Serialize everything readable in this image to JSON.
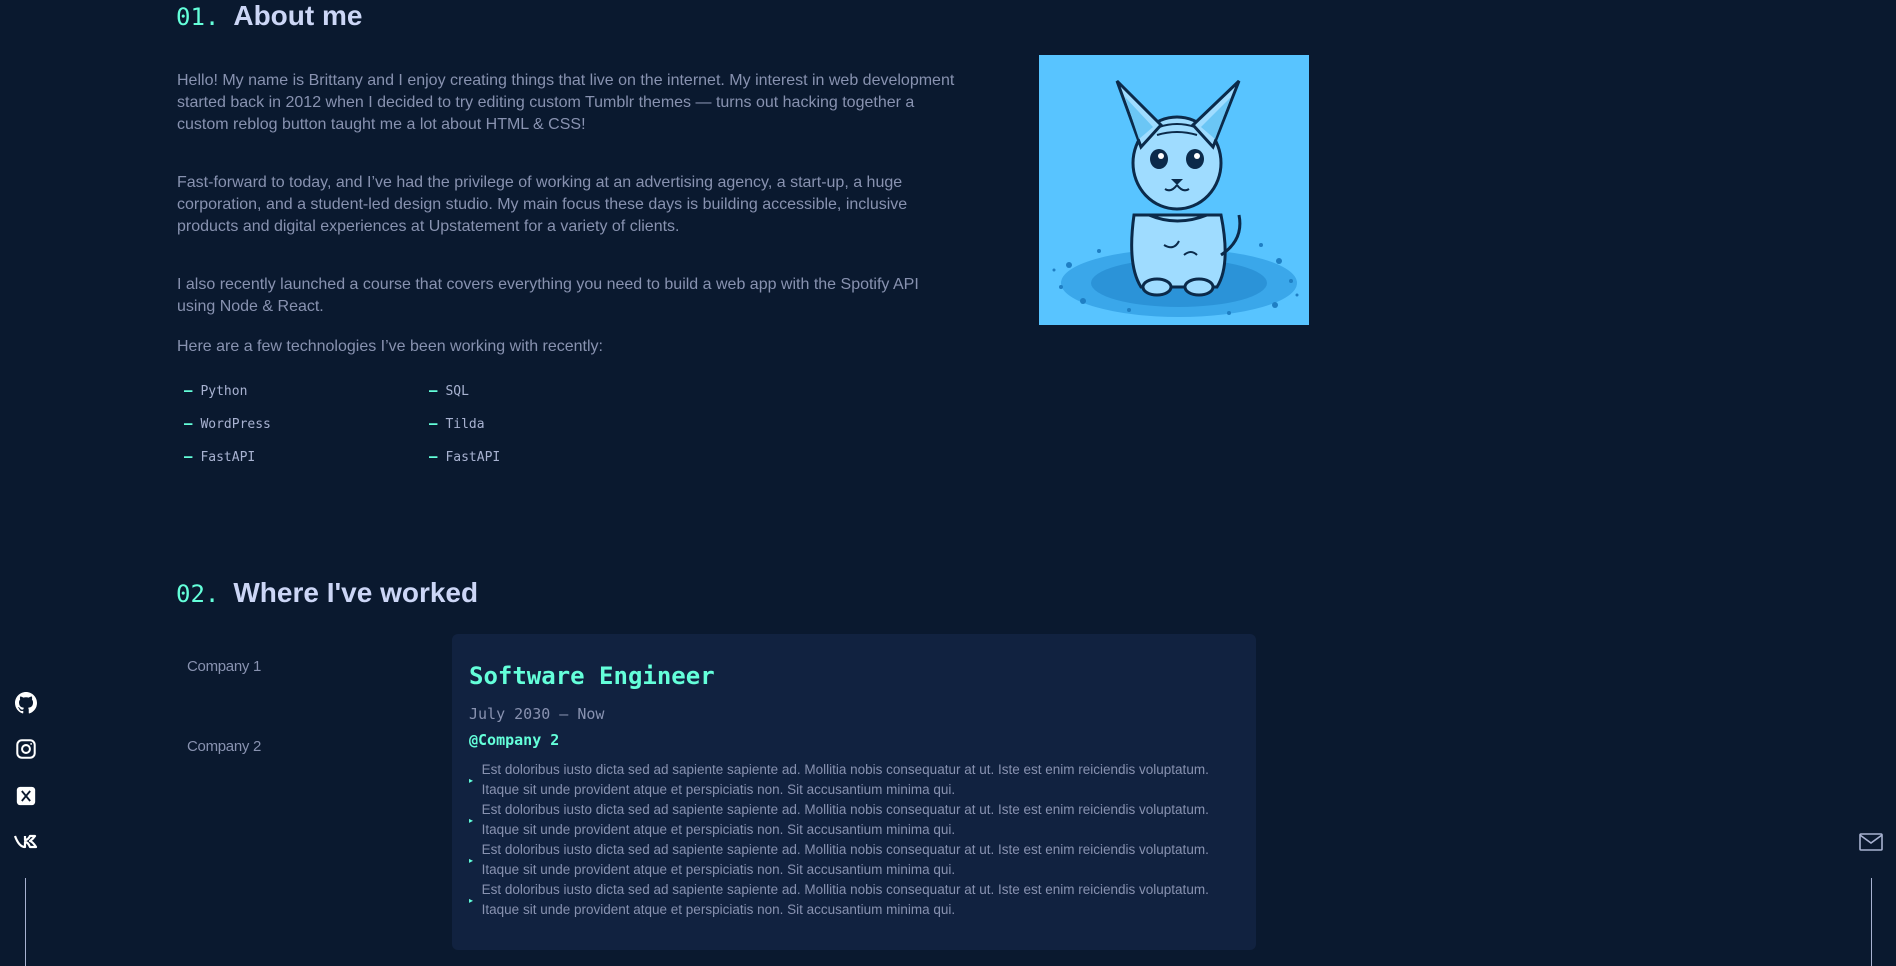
{
  "about": {
    "number": "01.",
    "title": "About me",
    "paragraphs": [
      "Hello! My name is Brittany and I enjoy creating things that live on the internet. My interest in web development started back in 2012 when I decided to try editing custom Tumblr themes — turns out hacking together a custom reblog button taught me a lot about HTML & CSS!",
      "Fast-forward to today, and I’ve had the privilege of working at an advertising agency, a start-up, a huge corporation, and a student-led design studio. My main focus these days is building accessible, inclusive products and digital experiences at Upstatement for a variety of clients.",
      "I also recently launched a course that covers everything you need to build a web app with the Spotify API using Node & React.",
      "Here are a few technologies I’ve been working with recently:"
    ],
    "skills": [
      "Python",
      "SQL",
      "WordPress",
      "Tilda",
      "FastAPI",
      "FastAPI"
    ],
    "skill_marker": "–"
  },
  "work": {
    "number": "02.",
    "title": "Where I've worked",
    "companies": [
      "Company 1",
      "Company 2"
    ],
    "job": {
      "title": "Software Engineer",
      "dates": "July 2030 – Now",
      "company": "@Company 2",
      "bullet_marker": "▸",
      "bullets": [
        "Est doloribus iusto dicta sed ad sapiente sapiente ad. Mollitia nobis consequatur at ut. Iste est enim reiciendis voluptatum. Itaque sit unde provident atque et perspiciatis non. Sit accusantium minima qui.",
        "Est doloribus iusto dicta sed ad sapiente sapiente ad. Mollitia nobis consequatur at ut. Iste est enim reiciendis voluptatum. Itaque sit unde provident atque et perspiciatis non. Sit accusantium minima qui.",
        "Est doloribus iusto dicta sed ad sapiente sapiente ad. Mollitia nobis consequatur at ut. Iste est enim reiciendis voluptatum. Itaque sit unde provident atque et perspiciatis non. Sit accusantium minima qui.",
        "Est doloribus iusto dicta sed ad sapiente sapiente ad. Mollitia nobis consequatur at ut. Iste est enim reiciendis voluptatum. Itaque sit unde provident atque et perspiciatis non. Sit accusantium minima qui."
      ]
    }
  },
  "social_icons": [
    "github-icon",
    "instagram-icon",
    "x-twitter-icon",
    "vk-icon"
  ],
  "email_icon": "mail-icon",
  "colors": {
    "background": "#0a192f",
    "accent": "#64ffda",
    "heading": "#ccd6f6",
    "text": "#8892b0",
    "card": "#112240",
    "avatar_bg": "#58c4ff"
  }
}
